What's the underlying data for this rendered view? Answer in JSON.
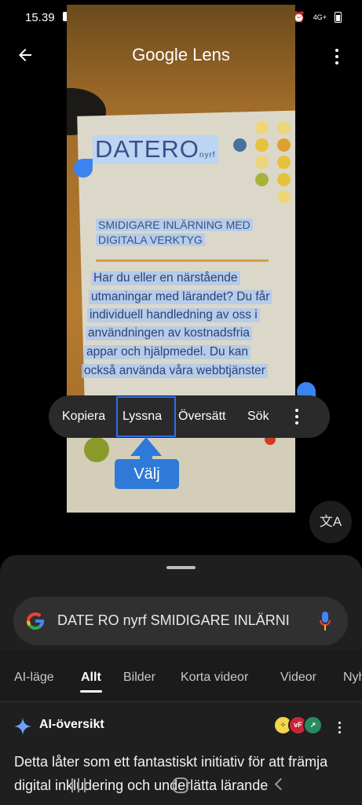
{
  "status": {
    "time": "15.39",
    "network": "4G+"
  },
  "header": {
    "title": "Google Lens"
  },
  "document": {
    "logo": "DATERO",
    "logo_suffix": "nyrf",
    "heading_lines": [
      "SMIDIGARE INLÄRNING MED",
      "DIGITALA VERKTYG"
    ],
    "body_lines": [
      "Har du eller en närstående",
      "utmaningar med lärandet? Du får",
      "individuell handledning av oss i",
      "användningen av kostnadsfria",
      "appar och hjälpmedel. Du kan",
      "också använda våra webbtjänster"
    ]
  },
  "context_menu": {
    "items": [
      "Kopiera",
      "Lyssna",
      "Översätt",
      "Sök"
    ],
    "selected": "Lyssna"
  },
  "callout": {
    "label": "Välj"
  },
  "translate_button": {
    "icon": "translate-icon",
    "glyph": "文A"
  },
  "search": {
    "query": "DATE RO nyrf SMIDIGARE INLÄRNI"
  },
  "tabs": [
    "AI-läge",
    "Allt",
    "Bilder",
    "Korta videor",
    "Videor",
    "Nyh"
  ],
  "active_tab": "Allt",
  "ai_overview": {
    "title": "AI-översikt",
    "text": "Detta låter som ett fantastiskt initiativ för att främja digital inkludering och underlätta lärande"
  },
  "colors": {
    "accent": "#2f7ad8",
    "selection": "#2d6df0",
    "sheet": "#1f1f1f"
  }
}
